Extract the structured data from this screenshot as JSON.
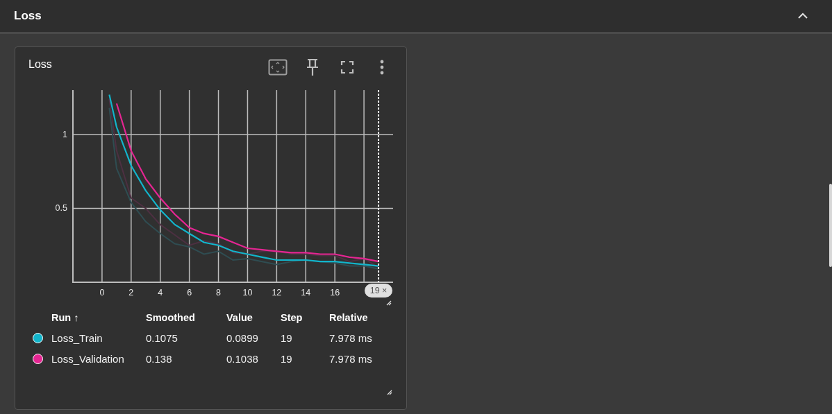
{
  "header": {
    "title": "Loss",
    "expanded": true
  },
  "card": {
    "title": "Loss",
    "chart_data": {
      "type": "line",
      "grid": true,
      "xlim": [
        -2,
        20
      ],
      "ylim": [
        0,
        1.3
      ],
      "xticks": [
        0,
        2,
        4,
        6,
        8,
        10,
        12,
        14,
        16
      ],
      "yticks": [
        0.5,
        1
      ],
      "x": [
        0.5,
        1,
        2,
        3,
        4,
        5,
        6,
        7,
        8,
        9,
        10,
        11,
        12,
        13,
        14,
        15,
        16,
        17,
        18,
        19
      ],
      "series": [
        {
          "color": "#2f4d52",
          "values": [
            1.18,
            0.77,
            0.54,
            0.41,
            0.33,
            0.26,
            0.24,
            0.19,
            0.21,
            0.15,
            0.16,
            0.14,
            0.12,
            0.14,
            0.15,
            0.14,
            0.13,
            0.11,
            0.11,
            0.09
          ]
        },
        {
          "color": "#4d3042",
          "values": [
            1.24,
            0.89,
            0.57,
            0.5,
            0.39,
            0.32,
            0.25,
            0.28,
            0.26,
            0.2,
            0.19,
            0.21,
            0.21,
            0.19,
            0.19,
            0.18,
            0.18,
            0.14,
            0.16,
            0.1
          ]
        },
        {
          "name": "Loss_Train",
          "color": "#12b5cb",
          "values": [
            1.27,
            1.05,
            0.79,
            0.62,
            0.49,
            0.39,
            0.33,
            0.27,
            0.25,
            0.21,
            0.19,
            0.17,
            0.15,
            0.15,
            0.15,
            0.14,
            0.14,
            0.13,
            0.12,
            0.11
          ]
        },
        {
          "name": "Loss_Validation",
          "color": "#e52592",
          "values": [
            null,
            1.21,
            0.89,
            0.7,
            0.57,
            0.46,
            0.37,
            0.33,
            0.31,
            0.27,
            0.23,
            0.22,
            0.21,
            0.2,
            0.2,
            0.19,
            0.19,
            0.17,
            0.16,
            0.14
          ]
        }
      ],
      "ref_lines": [
        {
          "axis": "x",
          "value": 19,
          "label": "19"
        }
      ]
    },
    "step_badge": {
      "close": "×"
    },
    "table": {
      "columns": [
        {
          "label": "Run",
          "sort": "↑"
        },
        {
          "label": "Smoothed"
        },
        {
          "label": "Value"
        },
        {
          "label": "Step"
        },
        {
          "label": "Relative"
        }
      ],
      "rows": [
        {
          "smoothed": "0.1075",
          "value": "0.0899",
          "step": "19",
          "relative": "7.978 ms"
        },
        {
          "smoothed": "0.138",
          "value": "0.1038",
          "step": "19",
          "relative": "7.978 ms"
        }
      ]
    }
  }
}
